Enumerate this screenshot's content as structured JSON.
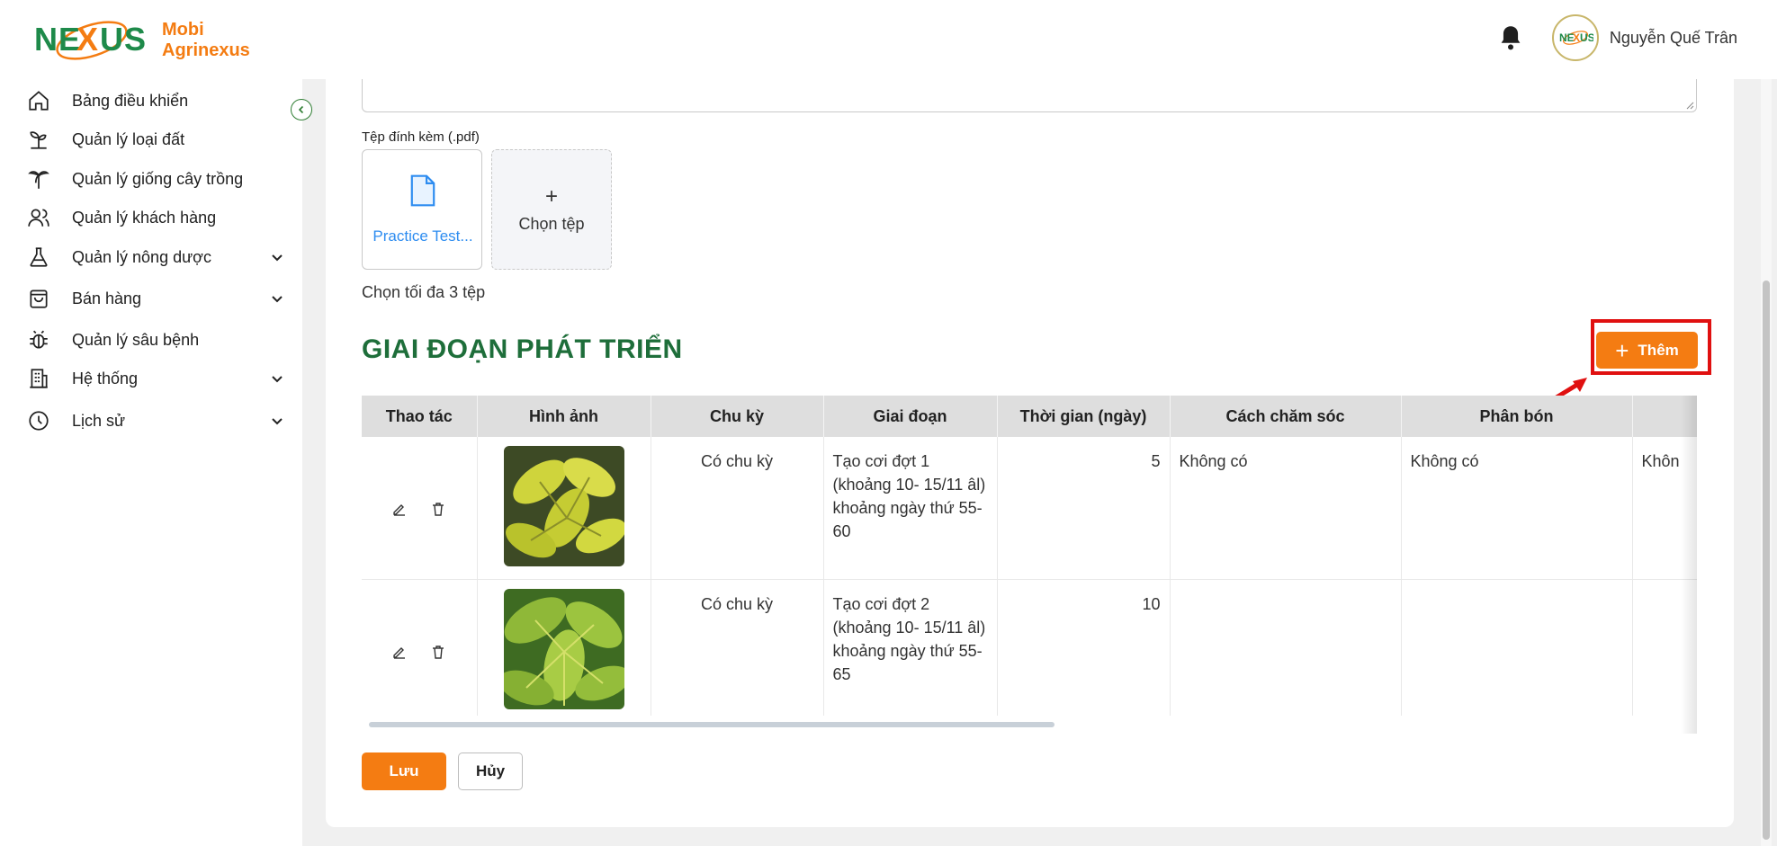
{
  "app": {
    "logo_line1": "Mobi",
    "logo_line2": "Agrinexus",
    "brand_mark": "NEXUS",
    "accent_color": "#f47c12",
    "brand_green": "#1e6e3a"
  },
  "header": {
    "user_name": "Nguyễn Quế Trân",
    "bell_icon": "bell-icon"
  },
  "sidebar": {
    "items": [
      {
        "label": "Bảng điều khiển",
        "icon": "home-icon"
      },
      {
        "label": "Quản lý loại đất",
        "icon": "sprout-icon"
      },
      {
        "label": "Quản lý giống cây trồng",
        "icon": "palm-tree-icon"
      },
      {
        "label": "Quản lý khách hàng",
        "icon": "users-icon"
      },
      {
        "label": "Quản lý nông dược",
        "icon": "flask-icon",
        "expandable": true
      },
      {
        "label": "Bán hàng",
        "icon": "shopping-bag-icon",
        "expandable": true
      },
      {
        "label": "Quản lý sâu bệnh",
        "icon": "bug-icon"
      },
      {
        "label": "Hệ thống",
        "icon": "building-icon",
        "expandable": true
      },
      {
        "label": "Lịch sử",
        "icon": "clock-icon",
        "expandable": true
      }
    ]
  },
  "form": {
    "attach_label": "Tệp đính kèm (.pdf)",
    "file_name": "Practice Test...",
    "upload_plus": "+",
    "upload_label": "Chọn tệp",
    "limit_text": "Chọn tối đa 3 tệp"
  },
  "section": {
    "title": "GIAI ĐOẠN PHÁT TRIỂN",
    "add_plus": "+",
    "add_label": "Thêm"
  },
  "table": {
    "columns": [
      "Thao tác",
      "Hình ảnh",
      "Chu kỳ",
      "Giai đoạn",
      "Thời gian (ngày)",
      "Cách chăm sóc",
      "Phân bón",
      ""
    ],
    "rows": [
      {
        "image": "leaf-photo-yellow",
        "cycle": "Có chu kỳ",
        "stage": "Tạo cơi đợt 1 (khoảng 10- 15/11 âl) khoảng ngày thứ 55-60",
        "days": "5",
        "care": "Không có",
        "fertilizer": "Không có",
        "extra": "Khôn"
      },
      {
        "image": "leaf-photo-green",
        "cycle": "Có chu kỳ",
        "stage": "Tạo cơi đợt 2 (khoảng 10- 15/11 âl) khoảng ngày thứ 55-65",
        "days": "10",
        "care": "",
        "fertilizer": "",
        "extra": ""
      }
    ]
  },
  "footer": {
    "save_label": "Lưu",
    "cancel_label": "Hủy"
  }
}
